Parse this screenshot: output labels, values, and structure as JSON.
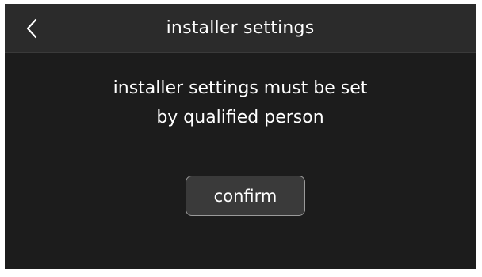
{
  "header": {
    "title": "installer settings",
    "back_icon": "chevron-left-icon"
  },
  "message": {
    "line1": "installer settings must be set",
    "line2": "by qualified person"
  },
  "actions": {
    "confirm_label": "confirm"
  }
}
